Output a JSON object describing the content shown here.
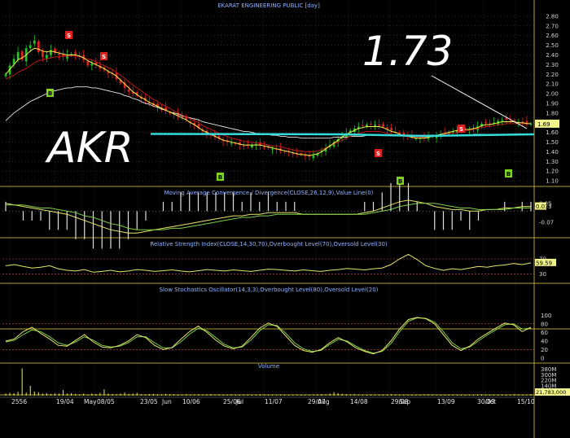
{
  "colors": {
    "up": "#22c322",
    "down": "#e02020",
    "ma_short": "#f0f050",
    "ma_mid": "#c01818",
    "ma_long": "#e8e8e8",
    "baseline": "#33dddd",
    "oscillator": "#e6e66a",
    "signal": "#7ecf4a",
    "grid": "#c8c8c8",
    "panel_border": "#b0a030",
    "tag_sell": "#e02020",
    "tag_buy": "#7ed321",
    "current_price_box": "#f2f28a"
  },
  "title": "EKARAT ENGINEERING PUBLIC [day]",
  "overlays": {
    "ticker": "AKR",
    "price_callout": "1.73"
  },
  "signals": {
    "buy": "B",
    "sell": "S"
  },
  "x_axis": {
    "labels": [
      "2556",
      "19/04",
      "May",
      "08/05",
      "23/05",
      "Jun",
      "10/06",
      "25/06",
      "Jul",
      "11/07",
      "29/07",
      "Aug",
      "14/08",
      "29/08",
      "Sep",
      "13/09",
      "30/09",
      "Oct",
      "15/10"
    ]
  },
  "chart_data": [
    {
      "type": "candlestick",
      "title": "EKARAT ENGINEERING PUBLIC [day]",
      "ylim": [
        1.05,
        2.85
      ],
      "y_ticks": [
        "2.80",
        "2.70",
        "2.60",
        "2.50",
        "2.40",
        "2.30",
        "2.20",
        "2.10",
        "2.00",
        "1.90",
        "1.80",
        "1.70",
        "1.60",
        "1.50",
        "1.40",
        "1.30",
        "1.20",
        "1.10"
      ],
      "last_label": "1.69",
      "close": [
        2.2,
        2.29,
        2.36,
        2.43,
        2.35,
        2.47,
        2.5,
        2.55,
        2.43,
        2.38,
        2.4,
        2.45,
        2.42,
        2.4,
        2.38,
        2.4,
        2.41,
        2.4,
        2.39,
        2.35,
        2.29,
        2.31,
        2.3,
        2.26,
        2.24,
        2.21,
        2.2,
        2.15,
        2.11,
        2.06,
        2.02,
        2.0,
        1.98,
        1.95,
        1.93,
        1.9,
        1.88,
        1.86,
        1.85,
        1.82,
        1.8,
        1.79,
        1.77,
        1.76,
        1.73,
        1.7,
        1.67,
        1.64,
        1.61,
        1.59,
        1.57,
        1.55,
        1.53,
        1.51,
        1.5,
        1.49,
        1.48,
        1.47,
        1.46,
        1.46,
        1.47,
        1.48,
        1.46,
        1.45,
        1.44,
        1.43,
        1.42,
        1.41,
        1.4,
        1.4,
        1.38,
        1.37,
        1.37,
        1.36,
        1.35,
        1.36,
        1.38,
        1.41,
        1.44,
        1.47,
        1.5,
        1.53,
        1.56,
        1.59,
        1.62,
        1.64,
        1.66,
        1.67,
        1.68,
        1.68,
        1.68,
        1.67,
        1.66,
        1.64,
        1.62,
        1.6,
        1.58,
        1.57,
        1.56,
        1.55,
        1.54,
        1.54,
        1.54,
        1.55,
        1.56,
        1.57,
        1.58,
        1.59,
        1.6,
        1.61,
        1.62,
        1.62,
        1.63,
        1.63,
        1.64,
        1.66,
        1.69,
        1.7,
        1.69,
        1.7,
        1.72,
        1.73,
        1.73,
        1.72,
        1.72,
        1.71,
        1.7,
        1.69,
        1.69
      ],
      "ma_short": [
        2.2,
        2.25,
        2.3,
        2.35,
        2.37,
        2.4,
        2.44,
        2.47,
        2.46,
        2.44,
        2.43,
        2.44,
        2.43,
        2.42,
        2.41,
        2.4,
        2.4,
        2.4,
        2.39,
        2.37,
        2.34,
        2.32,
        2.3,
        2.28,
        2.26,
        2.23,
        2.21,
        2.18,
        2.14,
        2.1,
        2.06,
        2.02,
        1.99,
        1.96,
        1.94,
        1.91,
        1.89,
        1.87,
        1.85,
        1.83,
        1.81,
        1.79,
        1.77,
        1.75,
        1.73,
        1.7,
        1.68,
        1.65,
        1.62,
        1.6,
        1.58,
        1.56,
        1.54,
        1.52,
        1.51,
        1.5,
        1.49,
        1.48,
        1.47,
        1.47,
        1.47,
        1.47,
        1.47,
        1.46,
        1.45,
        1.44,
        1.43,
        1.42,
        1.41,
        1.4,
        1.39,
        1.38,
        1.37,
        1.37,
        1.36,
        1.37,
        1.38,
        1.4,
        1.43,
        1.46,
        1.49,
        1.52,
        1.55,
        1.58,
        1.6,
        1.62,
        1.64,
        1.65,
        1.66,
        1.66,
        1.66,
        1.66,
        1.65,
        1.63,
        1.61,
        1.6,
        1.58,
        1.57,
        1.56,
        1.55,
        1.54,
        1.54,
        1.54,
        1.55,
        1.56,
        1.57,
        1.58,
        1.59,
        1.6,
        1.61,
        1.62,
        1.62,
        1.63,
        1.63,
        1.64,
        1.65,
        1.67,
        1.68,
        1.68,
        1.69,
        1.7,
        1.71,
        1.71,
        1.71,
        1.71,
        1.7,
        1.7,
        1.69,
        1.69
      ],
      "ma_mid": [
        2.15,
        2.17,
        2.19,
        2.22,
        2.24,
        2.26,
        2.29,
        2.32,
        2.34,
        2.35,
        2.36,
        2.37,
        2.38,
        2.38,
        2.39,
        2.39,
        2.39,
        2.39,
        2.38,
        2.37,
        2.36,
        2.35,
        2.33,
        2.31,
        2.29,
        2.27,
        2.25,
        2.22,
        2.19,
        2.16,
        2.12,
        2.09,
        2.06,
        2.03,
        2.0,
        1.97,
        1.94,
        1.92,
        1.89,
        1.87,
        1.85,
        1.82,
        1.8,
        1.78,
        1.76,
        1.74,
        1.72,
        1.7,
        1.67,
        1.65,
        1.63,
        1.61,
        1.59,
        1.57,
        1.56,
        1.54,
        1.53,
        1.52,
        1.51,
        1.5,
        1.5,
        1.49,
        1.49,
        1.48,
        1.47,
        1.46,
        1.46,
        1.45,
        1.44,
        1.43,
        1.42,
        1.41,
        1.41,
        1.4,
        1.4,
        1.4,
        1.41,
        1.42,
        1.44,
        1.46,
        1.48,
        1.5,
        1.52,
        1.54,
        1.56,
        1.58,
        1.59,
        1.6,
        1.61,
        1.61,
        1.61,
        1.61,
        1.6,
        1.59,
        1.58,
        1.57,
        1.57,
        1.56,
        1.56,
        1.55,
        1.55,
        1.55,
        1.55,
        1.55,
        1.56,
        1.56,
        1.57,
        1.58,
        1.59,
        1.59,
        1.6,
        1.61,
        1.62,
        1.62,
        1.63,
        1.64,
        1.65,
        1.66,
        1.66,
        1.67,
        1.68,
        1.68,
        1.69,
        1.69,
        1.69,
        1.69,
        1.69,
        1.69,
        1.69
      ],
      "ma_long": [
        1.72,
        1.76,
        1.8,
        1.83,
        1.86,
        1.89,
        1.92,
        1.94,
        1.96,
        1.98,
        2.0,
        2.02,
        2.03,
        2.04,
        2.05,
        2.06,
        2.06,
        2.07,
        2.07,
        2.07,
        2.07,
        2.06,
        2.06,
        2.05,
        2.04,
        2.03,
        2.02,
        2.01,
        2.0,
        1.98,
        1.97,
        1.95,
        1.94,
        1.92,
        1.9,
        1.89,
        1.87,
        1.86,
        1.84,
        1.83,
        1.81,
        1.8,
        1.79,
        1.77,
        1.76,
        1.75,
        1.74,
        1.73,
        1.71,
        1.7,
        1.69,
        1.68,
        1.67,
        1.66,
        1.65,
        1.64,
        1.63,
        1.62,
        1.61,
        1.61,
        1.6,
        1.59,
        1.59,
        1.58,
        1.58,
        1.57,
        1.57,
        1.56,
        1.56,
        1.55,
        1.55,
        1.55,
        1.54,
        1.54,
        1.54,
        1.54,
        1.54,
        1.54,
        1.54,
        1.54,
        1.55,
        1.55,
        1.55,
        1.55,
        1.56,
        1.56,
        1.56,
        1.56,
        1.57,
        1.57,
        1.57,
        1.57,
        1.57,
        1.57,
        1.57,
        1.57,
        1.57,
        1.57,
        1.57,
        1.57,
        1.57,
        1.57,
        1.57,
        1.57,
        1.57,
        1.57,
        1.57,
        1.57,
        1.57,
        1.57,
        1.57,
        1.57,
        1.57,
        1.57,
        1.58,
        1.58,
        1.58,
        1.58,
        1.58,
        1.58,
        1.58,
        1.58,
        1.58,
        1.58,
        1.58,
        1.58,
        1.58,
        1.58,
        1.58
      ],
      "baseline": 1.58
    },
    {
      "type": "line",
      "title": "Moving Average Convergence / Divergence(CLOSE,26,12,9),Value Line(0)",
      "ylim": [
        -0.16,
        0.08
      ],
      "y_ticks": [
        "0.05",
        "0.03",
        "-0.07"
      ],
      "last_label": "0.03",
      "series": [
        {
          "name": "MACD",
          "values": [
            0.05,
            0.04,
            0.03,
            0.02,
            0.01,
            0.0,
            -0.01,
            -0.02,
            -0.04,
            -0.06,
            -0.08,
            -0.1,
            -0.12,
            -0.13,
            -0.14,
            -0.14,
            -0.13,
            -0.12,
            -0.11,
            -0.1,
            -0.09,
            -0.08,
            -0.07,
            -0.06,
            -0.05,
            -0.04,
            -0.03,
            -0.03,
            -0.02,
            -0.02,
            -0.01,
            -0.01,
            -0.01,
            -0.01,
            -0.02,
            -0.02,
            -0.02,
            -0.02,
            -0.02,
            -0.02,
            -0.02,
            -0.01,
            0.0,
            0.02,
            0.04,
            0.06,
            0.07,
            0.06,
            0.05,
            0.03,
            0.02,
            0.01,
            0.01,
            0.0,
            0.0,
            0.01,
            0.01,
            0.02,
            0.02,
            0.03,
            0.03
          ]
        },
        {
          "name": "Signal",
          "values": [
            0.04,
            0.04,
            0.04,
            0.03,
            0.02,
            0.02,
            0.01,
            0.0,
            -0.01,
            -0.03,
            -0.04,
            -0.06,
            -0.08,
            -0.09,
            -0.11,
            -0.12,
            -0.12,
            -0.12,
            -0.12,
            -0.11,
            -0.11,
            -0.1,
            -0.09,
            -0.08,
            -0.07,
            -0.06,
            -0.05,
            -0.04,
            -0.04,
            -0.03,
            -0.03,
            -0.02,
            -0.02,
            -0.02,
            -0.02,
            -0.02,
            -0.02,
            -0.02,
            -0.02,
            -0.02,
            -0.02,
            -0.02,
            -0.01,
            0.0,
            0.01,
            0.03,
            0.04,
            0.05,
            0.05,
            0.05,
            0.04,
            0.03,
            0.02,
            0.02,
            0.01,
            0.01,
            0.01,
            0.01,
            0.02,
            0.02,
            0.02
          ]
        }
      ]
    },
    {
      "type": "line",
      "title": "Relative Strength Index(CLOSE,14,30,70),Overbought Level(70),Oversold Level(30)",
      "ylim": [
        10,
        100
      ],
      "y_ticks": [
        "70",
        "30"
      ],
      "last_label": "59.59",
      "overbought": 70,
      "oversold": 30,
      "series": [
        {
          "name": "RSI",
          "values": [
            52,
            55,
            50,
            46,
            48,
            52,
            44,
            40,
            38,
            42,
            35,
            37,
            40,
            36,
            38,
            42,
            40,
            37,
            39,
            41,
            38,
            36,
            39,
            42,
            40,
            38,
            41,
            39,
            37,
            40,
            43,
            42,
            40,
            38,
            41,
            39,
            37,
            40,
            42,
            45,
            43,
            41,
            44,
            46,
            55,
            70,
            82,
            68,
            52,
            45,
            40,
            44,
            42,
            46,
            50,
            48,
            52,
            54,
            58,
            55,
            59.59
          ]
        }
      ]
    },
    {
      "type": "line",
      "title": "Slow Stochastics Oscillator(14,3,3),Overbought Level(80),Oversold Level(20)",
      "ylim": [
        0,
        110
      ],
      "y_ticks": [
        "100",
        "80",
        "60",
        "40",
        "20",
        "0"
      ],
      "overbought": 80,
      "oversold": 20,
      "series": [
        {
          "name": "%K",
          "values": [
            40,
            45,
            62,
            72,
            58,
            45,
            30,
            28,
            42,
            55,
            38,
            26,
            24,
            30,
            40,
            55,
            48,
            30,
            20,
            25,
            44,
            62,
            75,
            60,
            42,
            28,
            22,
            28,
            48,
            70,
            82,
            74,
            52,
            30,
            18,
            14,
            20,
            36,
            48,
            38,
            24,
            16,
            10,
            18,
            40,
            68,
            90,
            95,
            92,
            80,
            55,
            30,
            18,
            28,
            45,
            58,
            70,
            82,
            78,
            62,
            72
          ]
        },
        {
          "name": "%D",
          "values": [
            38,
            42,
            55,
            66,
            62,
            50,
            36,
            30,
            38,
            50,
            42,
            30,
            26,
            28,
            36,
            50,
            50,
            36,
            24,
            24,
            38,
            56,
            70,
            64,
            48,
            32,
            24,
            26,
            42,
            64,
            78,
            76,
            58,
            36,
            22,
            16,
            18,
            32,
            44,
            40,
            28,
            18,
            12,
            16,
            34,
            62,
            86,
            94,
            93,
            84,
            62,
            36,
            22,
            26,
            40,
            54,
            66,
            78,
            80,
            68,
            70
          ]
        }
      ]
    },
    {
      "type": "bar",
      "title": "Volume",
      "ylim": [
        0,
        420
      ],
      "y_ticks": [
        "380M",
        "300M",
        "220M",
        "140M",
        "60M"
      ],
      "last_label": "21,783,000",
      "values": [
        30,
        40,
        35,
        55,
        390,
        45,
        140,
        60,
        50,
        30,
        35,
        25,
        30,
        30,
        80,
        30,
        35,
        25,
        20,
        30,
        15,
        30,
        25,
        40,
        90,
        30,
        25,
        20,
        30,
        45,
        25,
        30,
        40,
        20,
        18,
        22,
        25,
        20,
        18,
        25,
        20,
        20,
        15,
        18,
        20,
        16,
        18,
        20,
        15,
        18,
        22,
        15,
        20,
        18,
        16,
        20,
        14,
        16,
        15,
        18,
        14,
        16,
        20,
        18,
        15,
        17,
        14,
        16,
        15,
        13,
        14,
        16,
        18,
        15,
        14,
        17,
        20,
        22,
        18,
        30,
        50,
        35,
        28,
        22,
        18,
        20,
        16,
        14,
        15,
        13,
        15,
        18,
        14,
        16,
        20,
        18,
        15,
        14,
        13,
        15,
        14,
        16,
        18,
        20,
        17,
        15,
        14,
        13,
        16,
        15,
        14,
        13,
        12,
        14,
        15,
        18,
        20,
        16,
        14,
        13,
        15,
        16,
        14,
        13,
        22,
        18,
        15,
        14,
        22
      ]
    }
  ]
}
